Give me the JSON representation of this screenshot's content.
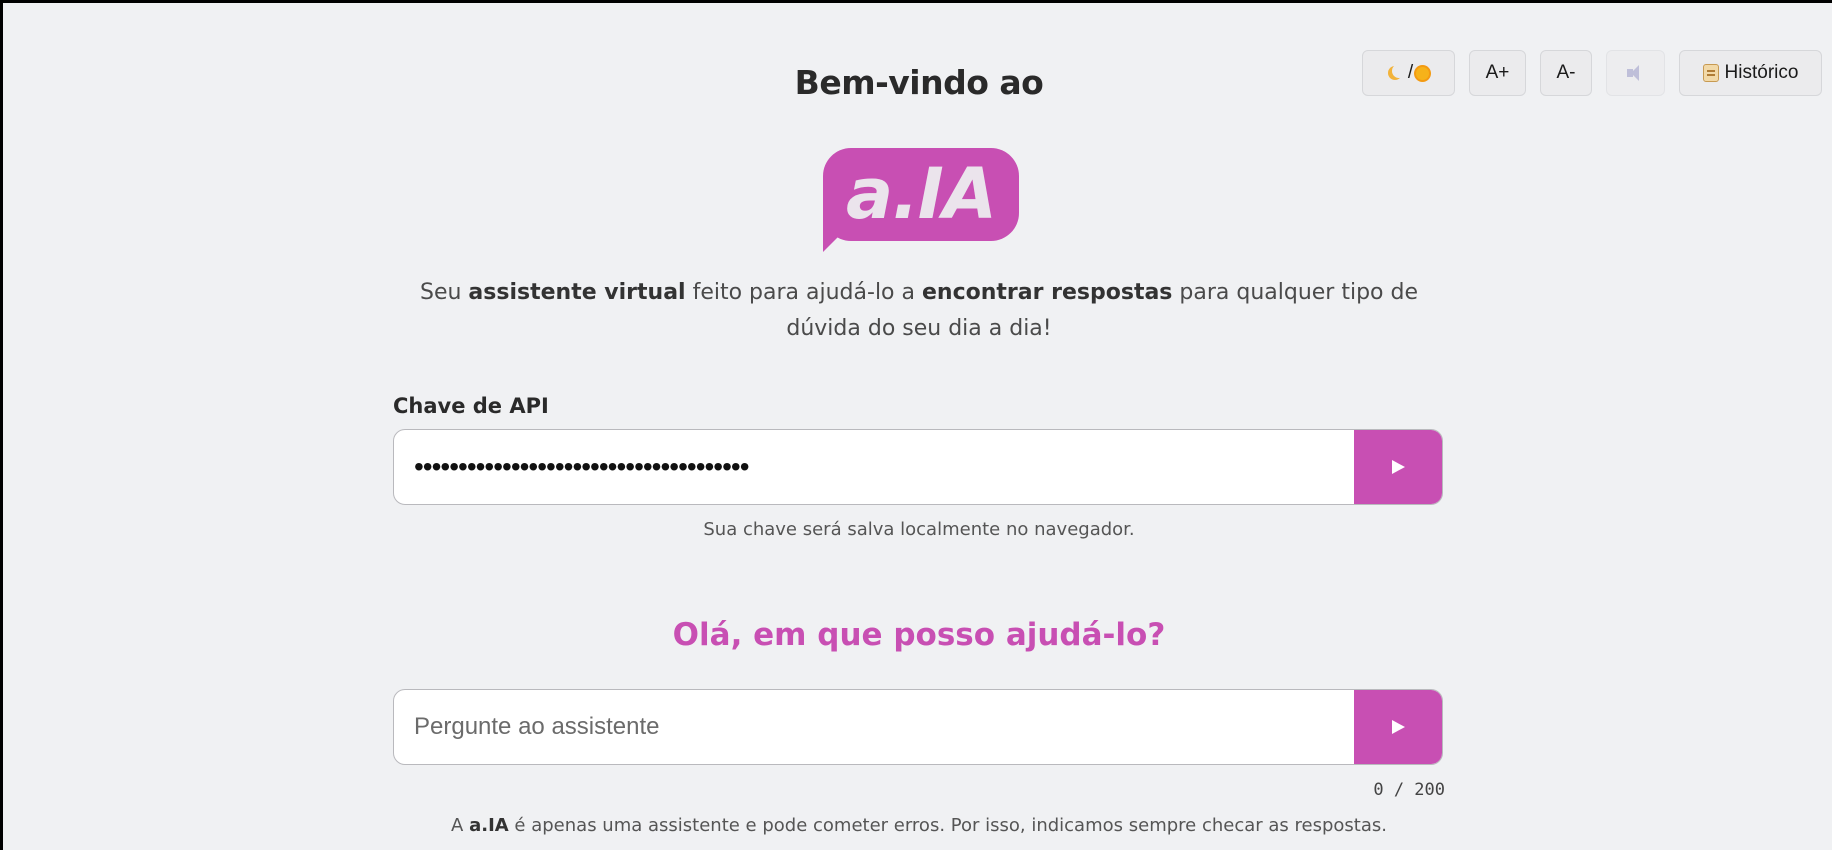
{
  "toolbar": {
    "theme_slash": "/",
    "font_increase_label": "A+",
    "font_decrease_label": "A-",
    "history_label": "Histórico",
    "icons": {
      "theme": [
        "moon-icon",
        "sun-icon"
      ],
      "sound": "speaker-icon",
      "history": "scroll-icon"
    }
  },
  "header": {
    "title": "Bem-vindo ao",
    "logo_text": "a.IA"
  },
  "intro": {
    "part1": "Seu ",
    "bold1": "assistente virtual",
    "part2": " feito para ajudá-lo a ",
    "bold2": "encontrar respostas",
    "part3": " para qualquer tipo de dúvida do seu dia a dia!"
  },
  "api_key": {
    "label": "Chave de API",
    "value": "••••••••••••••••••••••••••••••••••••••",
    "hint": "Sua chave será salva localmente no navegador."
  },
  "chat": {
    "greeting": "Olá, em que posso ajudá-lo?",
    "placeholder": "Pergunte ao assistente",
    "counter": "0 / 200"
  },
  "disclaimer": {
    "part1": "A ",
    "bold": "a.IA",
    "part2": " é apenas uma assistente e pode cometer erros. Por isso, indicamos sempre checar as respostas."
  },
  "colors": {
    "accent": "#c84fb3",
    "background": "#f0f1f3",
    "text": "#2a2a2a"
  }
}
